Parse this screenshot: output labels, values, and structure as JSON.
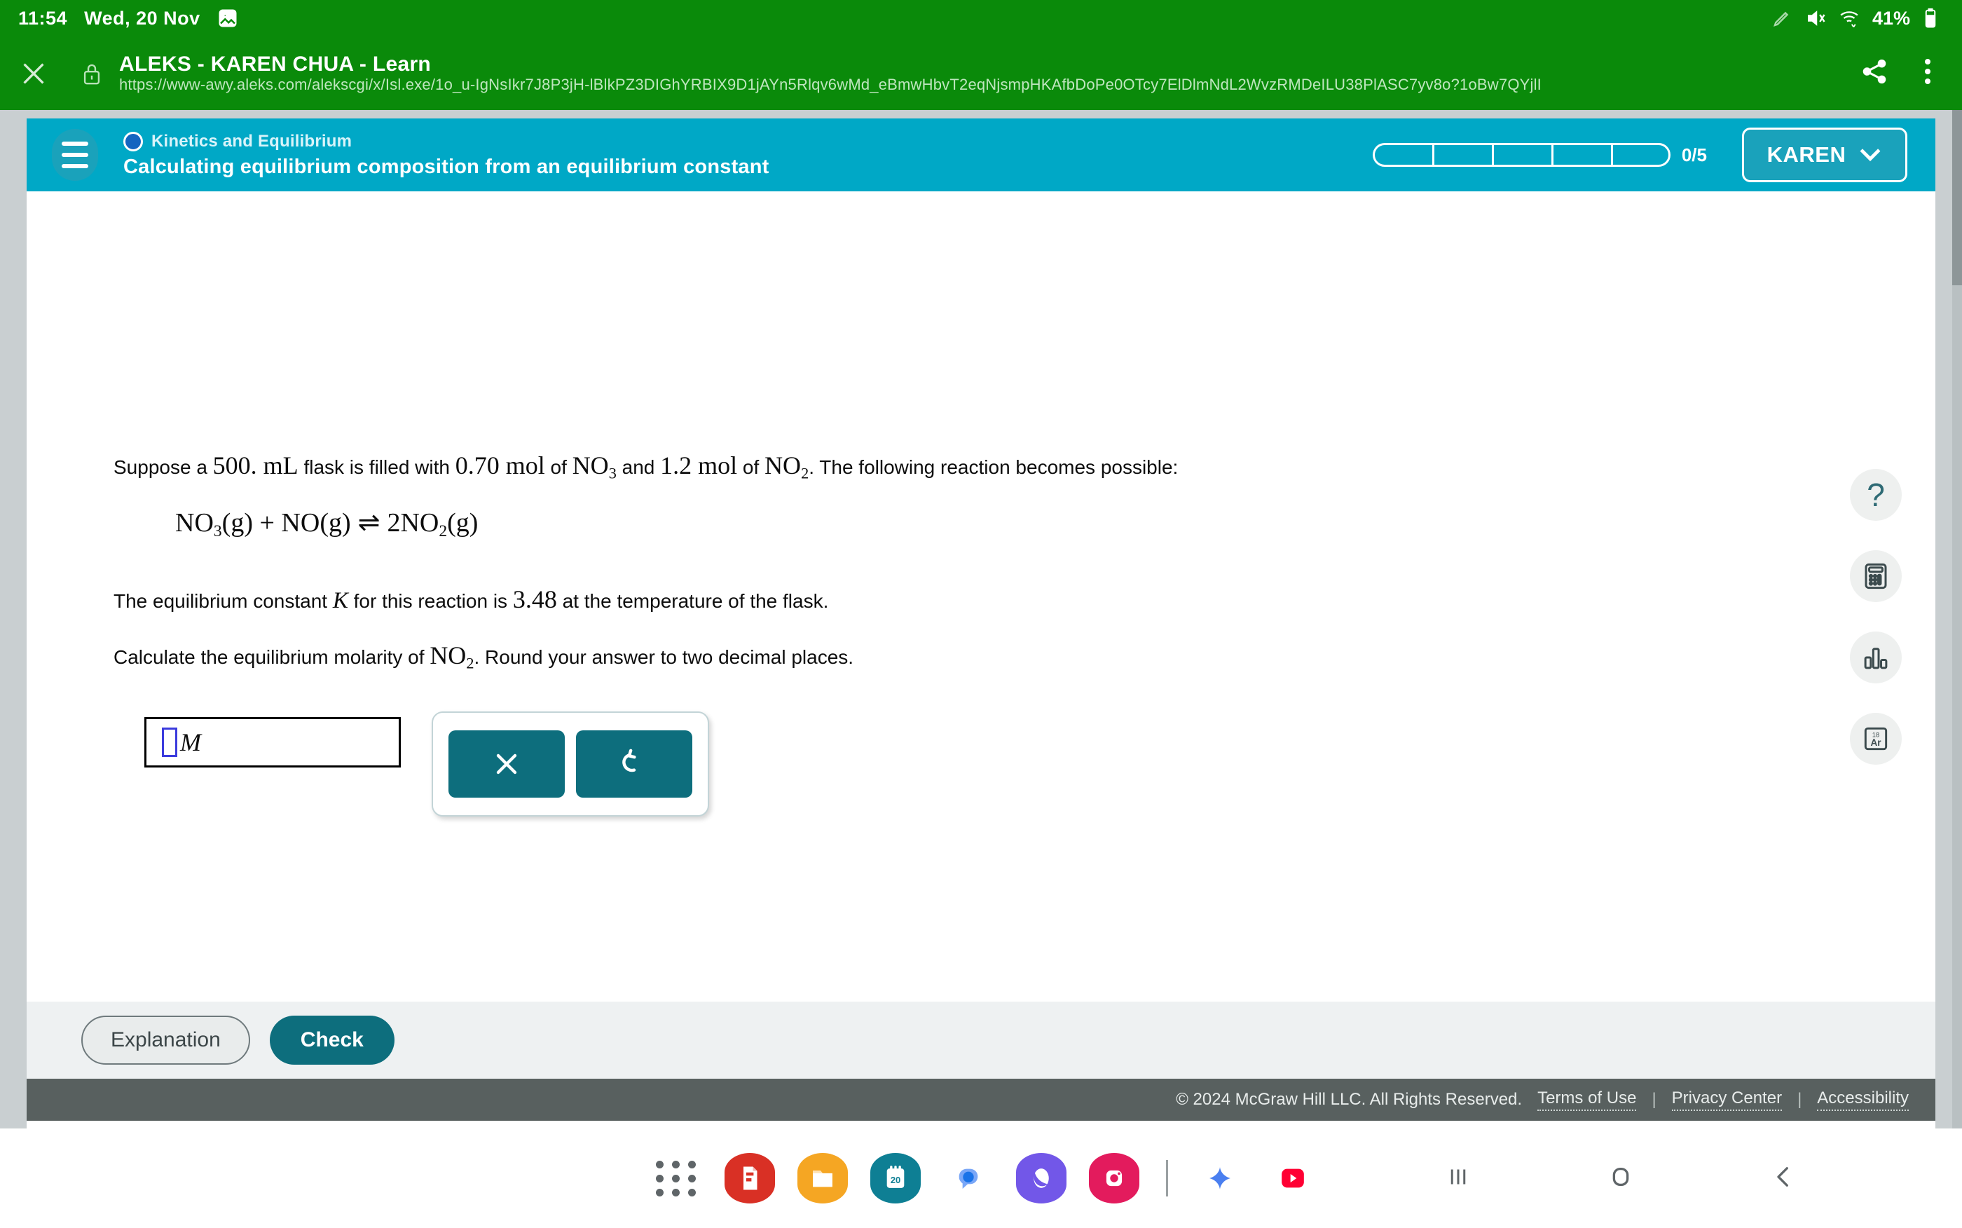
{
  "status_bar": {
    "time": "11:54",
    "date": "Wed, 20 Nov",
    "battery_percent": "41%",
    "icons": [
      "image-icon",
      "pen-icon",
      "volume-muted-icon",
      "wifi-icon",
      "battery-icon"
    ]
  },
  "browser": {
    "title": "ALEKS - KAREN CHUA - Learn",
    "url": "https://www-awy.aleks.com/alekscgi/x/Isl.exe/1o_u-IgNsIkr7J8P3jH-lBlkPZ3DIGhYRBIX9D1jAYn5Rlqv6wMd_eBmwHbvT2eqNjsmpHKAfbDoPe0OTcy7ElDlmNdL2WvzRMDeILU38PlASC7yv8o?1oBw7QYjlI",
    "close_label": "✕",
    "share_label": "share-icon",
    "menu_label": "more-options-icon"
  },
  "header": {
    "topic": "Kinetics and Equilibrium",
    "objective": "Calculating equilibrium composition from an equilibrium constant",
    "progress_count": "0/5",
    "progress_segments": 5,
    "progress_filled": 0,
    "user_name": "KAREN",
    "accent_color": "#00a8c6"
  },
  "question": {
    "line1_a": "Suppose a ",
    "volume": "500.",
    "volume_unit": " mL",
    "line1_b": " flask is filled with ",
    "amount1": "0.70",
    "amount1_unit": " mol",
    "line1_c": " of ",
    "species1": "NO",
    "species1_sub": "3",
    "line1_d": " and ",
    "amount2": "1.2",
    "amount2_unit": " mol",
    "line1_e": " of ",
    "species2": "NO",
    "species2_sub": "2",
    "line1_f": ". The following reaction becomes possible:",
    "equation": {
      "reactant1": "NO",
      "reactant1_sub": "3",
      "reactant1_state": "(g)",
      "plus": " + ",
      "reactant2": "NO",
      "reactant2_state": "(g)",
      "arrow": "⇌",
      "product_coeff": "2",
      "product": "NO",
      "product_sub": "2",
      "product_state": "(g)"
    },
    "line2_a": "The equilibrium constant ",
    "constant_symbol": "K",
    "line2_b": " for this reaction is ",
    "constant_value": "3.48",
    "line2_c": " at the temperature of the flask.",
    "line3_a": "Calculate the equilibrium molarity of ",
    "target_species": "NO",
    "target_species_sub": "2",
    "line3_b": ". Round your answer to two decimal places."
  },
  "answer": {
    "value": "",
    "unit": "M",
    "clear_label": "✕",
    "undo_label": "↺"
  },
  "right_rail": [
    {
      "name": "help-icon",
      "label": "?"
    },
    {
      "name": "calculator-icon",
      "label": "calculator"
    },
    {
      "name": "data-chart-icon",
      "label": "data"
    },
    {
      "name": "periodic-table-icon",
      "label": "Ar",
      "number": "18"
    }
  ],
  "actions": {
    "explanation_label": "Explanation",
    "check_label": "Check"
  },
  "footer": {
    "copyright": "© 2024 McGraw Hill LLC. All Rights Reserved.",
    "links": [
      "Terms of Use",
      "Privacy Center",
      "Accessibility"
    ],
    "separator": "|"
  },
  "dock": {
    "apps": [
      {
        "name": "app-drawer-icon",
        "color": "#5f6568"
      },
      {
        "name": "pdf-app-icon",
        "color": "#d93025"
      },
      {
        "name": "files-app-icon",
        "color": "#f5a623"
      },
      {
        "name": "calendar-app-icon",
        "color": "#0e7f94",
        "label": "20"
      },
      {
        "name": "messages-app-icon",
        "color": "#1a73e8"
      },
      {
        "name": "gallery-app-icon",
        "color": "#7257e8"
      },
      {
        "name": "instagram-app-icon",
        "color": "#e31b5d"
      },
      {
        "name": "gemini-app-icon",
        "color": "#4a7ff0"
      },
      {
        "name": "youtube-app-icon",
        "color": "#ff0033"
      }
    ]
  },
  "nav_bar": {
    "recents_label": "recents-icon",
    "home_label": "home-icon",
    "back_label": "back-icon"
  }
}
